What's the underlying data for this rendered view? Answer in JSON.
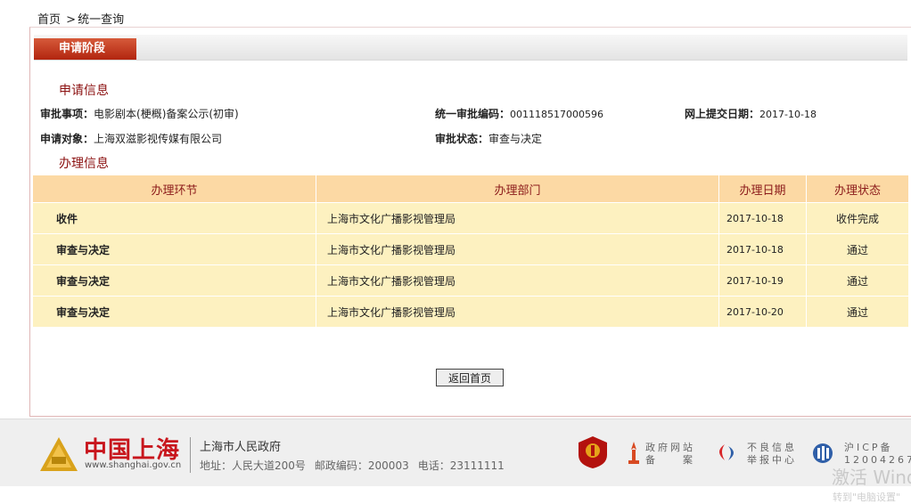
{
  "breadcrumb": {
    "home": "首页",
    "separator": ">",
    "current": "统一查询"
  },
  "stage_tab": "申请阶段",
  "sections": {
    "apply_info": "申请信息",
    "process_info": "办理信息"
  },
  "apply_info": {
    "item_label": "审批事项：",
    "item_value": "电影剧本(梗概)备案公示(初审)",
    "code_label": "统一审批编码：",
    "code_value": "001118517000596",
    "date_label": "网上提交日期：",
    "date_value": "2017-10-18",
    "target_label": "申请对象：",
    "target_value": "上海双滋影视传媒有限公司",
    "status_label": "审批状态：",
    "status_value": "审查与决定"
  },
  "table": {
    "headers": [
      "办理环节",
      "办理部门",
      "办理日期",
      "办理状态"
    ],
    "rows": [
      [
        "收件",
        "上海市文化广播影视管理局",
        "2017-10-18",
        "收件完成"
      ],
      [
        "审查与决定",
        "上海市文化广播影视管理局",
        "2017-10-18",
        "通过"
      ],
      [
        "审查与决定",
        "上海市文化广播影视管理局",
        "2017-10-19",
        "通过"
      ],
      [
        "审查与决定",
        "上海市文化广播影视管理局",
        "2017-10-20",
        "通过"
      ]
    ]
  },
  "back_button": "返回首页",
  "footer": {
    "logo_title": "中国上海",
    "logo_url": "www.shanghai.gov.cn",
    "gov_name": "上海市人民政府",
    "address": "地址：人民大道200号",
    "postcode": "邮政编码：200003",
    "phone": "电话：23111111",
    "gov_site_line1": "政府网站",
    "gov_site_line2": "备　　案",
    "report_line1": "不良信息",
    "report_line2": "举报中心",
    "icp_line1": "沪ICP备",
    "icp_line2": "12004267",
    "colors": {
      "brand_red": "#c8161d",
      "header_orange": "#fcd9a4",
      "row_cream": "#fdf1c0"
    }
  },
  "watermark": {
    "line1": "激活 Wind",
    "line2": "转到\"电脑设置\""
  }
}
